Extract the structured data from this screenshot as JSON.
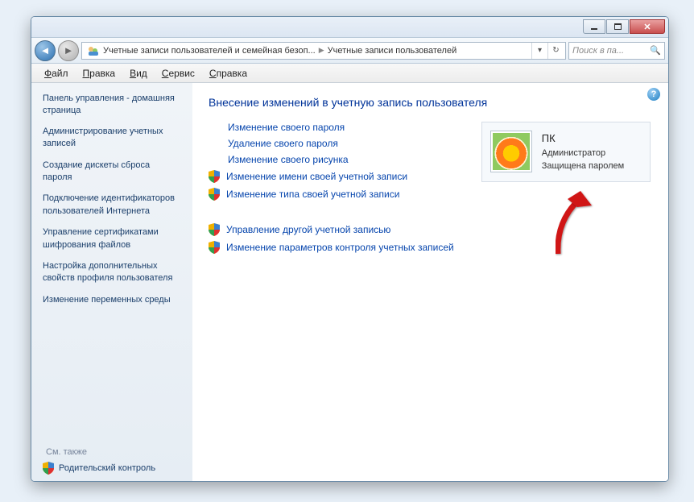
{
  "breadcrumb": {
    "part1": "Учетные записи пользователей и семейная безоп...",
    "part2": "Учетные записи пользователей"
  },
  "search": {
    "placeholder": "Поиск в па..."
  },
  "menu": {
    "file": "Файл",
    "edit": "Правка",
    "view": "Вид",
    "service": "Сервис",
    "help": "Справка"
  },
  "sidebar": {
    "home": "Панель управления - домашняя страница",
    "items": [
      "Администрирование учетных записей",
      "Создание дискеты сброса пароля",
      "Подключение идентификаторов пользователей Интернета",
      "Управление сертификатами шифрования файлов",
      "Настройка дополнительных свойств профиля пользователя",
      "Изменение переменных среды"
    ],
    "see_also_label": "См. также",
    "parental": "Родительский контроль"
  },
  "main": {
    "heading": "Внесение изменений в учетную запись пользователя",
    "group1": [
      {
        "shield": false,
        "label": "Изменение своего пароля"
      },
      {
        "shield": false,
        "label": "Удаление своего пароля"
      },
      {
        "shield": false,
        "label": "Изменение своего рисунка"
      },
      {
        "shield": true,
        "label": "Изменение имени своей учетной записи"
      },
      {
        "shield": true,
        "label": "Изменение типа своей учетной записи"
      }
    ],
    "group2": [
      {
        "shield": true,
        "label": "Управление другой учетной записью"
      },
      {
        "shield": true,
        "label": "Изменение параметров контроля учетных записей"
      }
    ],
    "user": {
      "name": "ПК",
      "role": "Администратор",
      "status": "Защищена паролем"
    }
  }
}
